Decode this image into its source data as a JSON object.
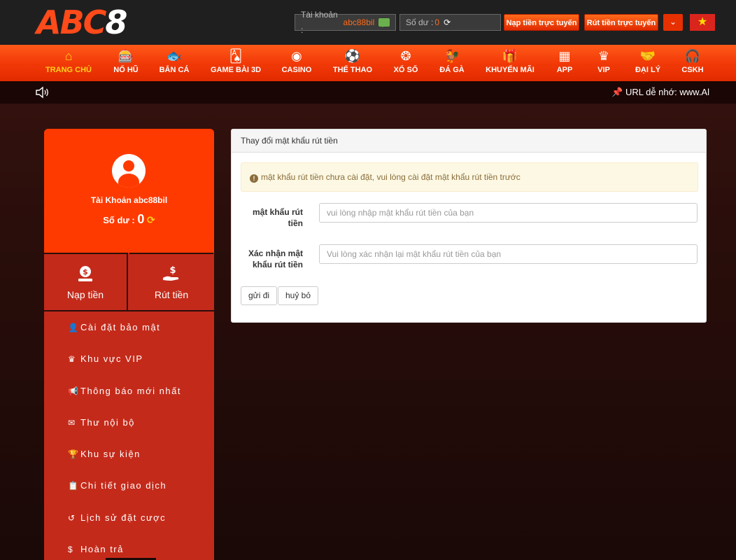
{
  "header": {
    "logo_text_a": "ABC",
    "logo_text_b": "8",
    "account_label": "Tài khoản :",
    "account_value": "abc88bil",
    "balance_label": "Số dư :",
    "balance_value": "0",
    "deposit_btn": "Nạp tiền trực tuyến",
    "withdraw_btn": "Rút tiền trực tuyến",
    "dropdown_icon": "chevron-down",
    "flag_icon": "vietnam-flag"
  },
  "nav": {
    "items": [
      {
        "label": "TRANG CHỦ",
        "icon": "home",
        "active": true
      },
      {
        "label": "NỔ HŨ",
        "icon": "slot-machine"
      },
      {
        "label": "BẮN CÁ",
        "icon": "fish"
      },
      {
        "label": "GAME BÀI 3D",
        "icon": "cards"
      },
      {
        "label": "CASINO",
        "icon": "chip"
      },
      {
        "label": "THỂ THAO",
        "icon": "soccer-ball"
      },
      {
        "label": "XỔ SỐ",
        "icon": "lottery"
      },
      {
        "label": "ĐÁ GÀ",
        "icon": "rooster"
      },
      {
        "label": "KHUYẾN MÃI",
        "icon": "gift"
      },
      {
        "label": "APP",
        "icon": "grid"
      },
      {
        "label": "VIP",
        "icon": "crown"
      },
      {
        "label": "ĐẠI LÝ",
        "icon": "handshake"
      },
      {
        "label": "CSKH",
        "icon": "headset"
      }
    ]
  },
  "marquee": {
    "speaker_icon": "speaker",
    "text": "URL dễ nhớ: www.Al"
  },
  "sidebar": {
    "account_label": "Tài Khoản abc88bil",
    "balance_label": "Số dư :",
    "balance_value": "0",
    "deposit": "Nạp tiền",
    "withdraw": "Rút tiền",
    "menu": [
      {
        "label": "Cài đặt bảo mật",
        "icon": "user-lock"
      },
      {
        "label": "Khu vực VIP",
        "icon": "vip-crown"
      },
      {
        "label": "Thông báo mới nhất",
        "icon": "megaphone"
      },
      {
        "label": "Thư nội bộ",
        "icon": "envelope"
      },
      {
        "label": "Khu sự kiện",
        "icon": "trophy"
      },
      {
        "label": "Chi tiết giao dịch",
        "icon": "clipboard"
      },
      {
        "label": "Lịch sử đặt cược",
        "icon": "history"
      },
      {
        "label": "Hoàn trả",
        "icon": "dollar-circle"
      }
    ]
  },
  "panel": {
    "title": "Thay đổi mật khẩu rút tiền",
    "alert": "mật khẩu rút tiền chưa cài đặt, vui lòng cài đặt mật khẩu rút tiền trước",
    "field1_label_line1": "mật khẩu rút",
    "field1_label_line2": "tiền",
    "field1_placeholder": "vui lòng nhập mật khẩu rút tiền của bạn",
    "field2_label_line1": "Xác nhận mật",
    "field2_label_line2": "khẩu rút tiền",
    "field2_placeholder": "Vui lòng xác nhận lại mật khẩu rút tiền của bạn",
    "submit": "gửi đi",
    "cancel": "huỷ bỏ"
  },
  "colors": {
    "brand": "#ff3a00",
    "nav_active": "#ffd21a",
    "sidebar": "#c42a1a"
  }
}
